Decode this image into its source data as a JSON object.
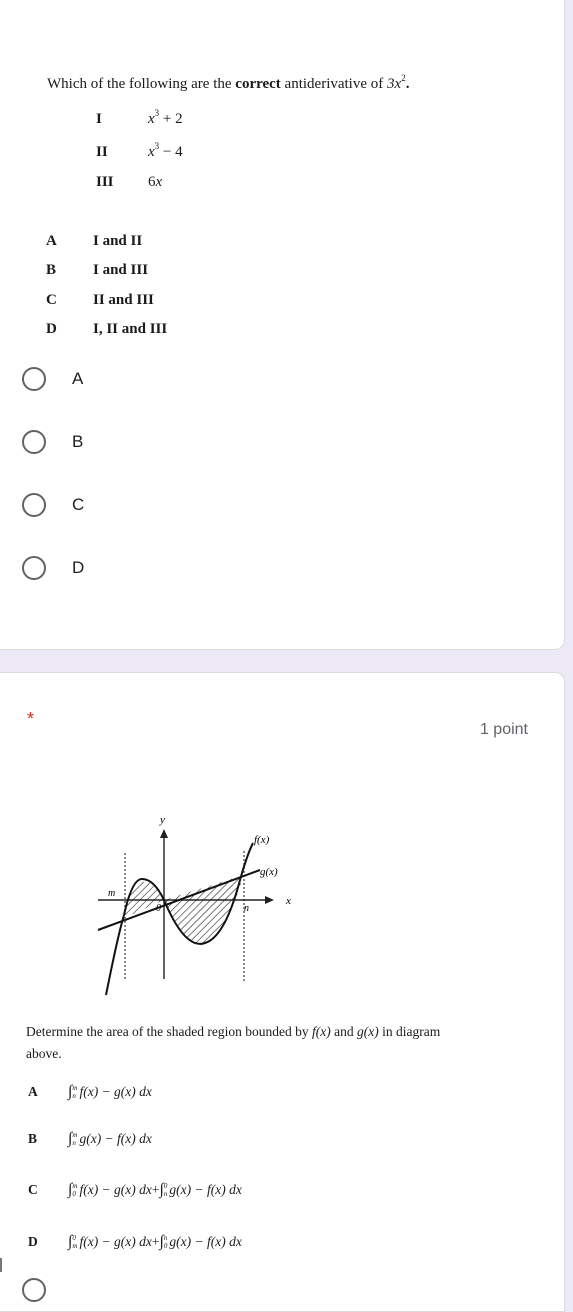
{
  "question1": {
    "title_prefix": "Which  of the following are the ",
    "title_bold": "correct",
    "title_suffix": " antiderivative of ",
    "title_expr_base": "3x",
    "title_expr_exp": "2",
    "title_end": ".",
    "statements": [
      {
        "num": "I",
        "base": "x",
        "exp": "3",
        "rest": " + 2"
      },
      {
        "num": "II",
        "base": "x",
        "exp": "3",
        "rest": " − 4"
      },
      {
        "num": "III",
        "base": "6",
        "exp": "",
        "rest": "x"
      }
    ],
    "choices": [
      {
        "letter": "A",
        "text": "I and II"
      },
      {
        "letter": "B",
        "text": "I and III"
      },
      {
        "letter": "C",
        "text": "II and III"
      },
      {
        "letter": "D",
        "text": "I, II and III"
      }
    ],
    "radio_options": [
      "A",
      "B",
      "C",
      "D"
    ]
  },
  "question2": {
    "required_marker": "*",
    "points": "1 point",
    "diagram": {
      "y_label": "y",
      "x_label": "x",
      "origin_label": "0",
      "m_label": "m",
      "n_label": "n",
      "f_label": "f(x)",
      "g_label": "g(x)"
    },
    "prompt_line1_a": "Determine the area of the shaded region bounded by ",
    "prompt_f": "f(x)",
    "prompt_and": " and ",
    "prompt_g": "g(x)",
    "prompt_line1_b": " in diagram",
    "prompt_line2": "above.",
    "answers": [
      {
        "letter": "A",
        "terms": [
          {
            "upper": "m",
            "lower": "n",
            "integrand": "f(x) − g(x) dx"
          }
        ]
      },
      {
        "letter": "B",
        "terms": [
          {
            "upper": "m",
            "lower": "n",
            "integrand": "g(x) − f(x) dx"
          }
        ]
      },
      {
        "letter": "C",
        "terms": [
          {
            "upper": "m",
            "lower": "0",
            "integrand": "f(x) − g(x) dx"
          },
          {
            "upper": "0",
            "lower": "n",
            "integrand": "g(x) − f(x) dx"
          }
        ]
      },
      {
        "letter": "D",
        "terms": [
          {
            "upper": "0",
            "lower": "m",
            "integrand": "f(x) − g(x) dx"
          },
          {
            "upper": "n",
            "lower": "0",
            "integrand": "g(x) − f(x) dx"
          }
        ]
      }
    ],
    "plus": " + "
  }
}
